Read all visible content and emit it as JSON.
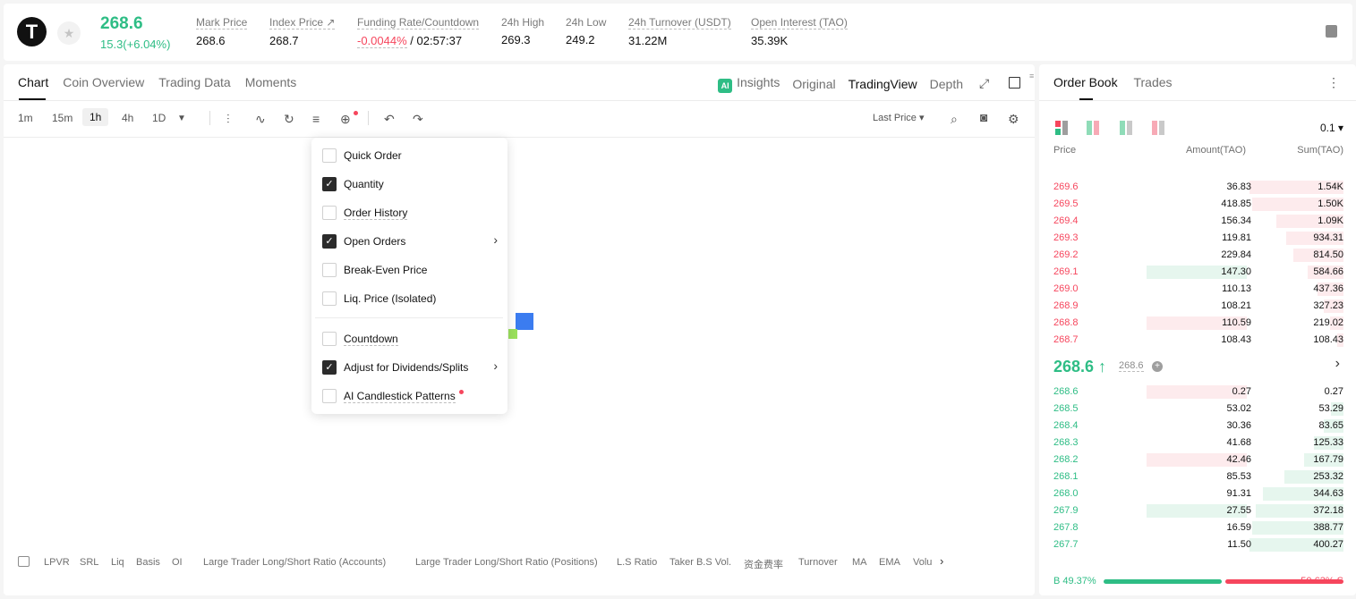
{
  "header": {
    "logo_letter": "T",
    "last_price": "268.6",
    "change": "15.3(+6.04%)",
    "stats": [
      {
        "label": "Mark Price",
        "value": "268.6"
      },
      {
        "label": "Index Price ↗",
        "value": "268.7"
      },
      {
        "label": "Funding Rate/Countdown",
        "value_red": "-0.0044%",
        "value": " / 02:57:37"
      },
      {
        "label": "24h High",
        "value": "269.3"
      },
      {
        "label": "24h Low",
        "value": "249.2"
      },
      {
        "label": "24h Turnover (USDT)",
        "value": "31.22M"
      },
      {
        "label": "Open Interest (TAO)",
        "value": "35.39K"
      }
    ]
  },
  "chart_tabs": [
    "Chart",
    "Coin Overview",
    "Trading Data",
    "Moments"
  ],
  "views": {
    "ai_badge": "AI",
    "insights": "Insights",
    "original": "Original",
    "tradingview": "TradingView",
    "depth": "Depth"
  },
  "intervals": [
    "1m",
    "15m",
    "1h",
    "4h",
    "1D"
  ],
  "toolbar": {
    "last_price": "Last Price ▾"
  },
  "dropdown": {
    "items": [
      {
        "label": "Quick Order",
        "checked": false,
        "arrow": false
      },
      {
        "label": "Quantity",
        "checked": true,
        "arrow": false
      },
      {
        "label": "Order History",
        "checked": false,
        "arrow": false
      },
      {
        "label": "Open Orders",
        "checked": true,
        "arrow": true
      },
      {
        "label": "Break-Even Price",
        "checked": false,
        "arrow": false
      },
      {
        "label": "Liq. Price (Isolated)",
        "checked": false,
        "arrow": false
      },
      {
        "label": "Countdown",
        "checked": false,
        "arrow": false
      },
      {
        "label": "Adjust for Dividends/Splits",
        "checked": true,
        "arrow": true
      },
      {
        "label": "AI Candlestick Patterns",
        "checked": false,
        "arrow": false
      }
    ]
  },
  "indicators": [
    "LPVR",
    "SRL",
    "Liq",
    "Basis",
    "OI",
    "Large Trader Long/Short Ratio (Accounts)",
    "Large Trader Long/Short Ratio (Positions)",
    "L.S Ratio",
    "Taker B.S Vol.",
    "资金费率",
    "Turnover",
    "MA",
    "EMA",
    "Volu"
  ],
  "orderbook": {
    "tabs": [
      "Order Book",
      "Trades"
    ],
    "step": "0.1 ▾",
    "headers": {
      "price": "Price",
      "amount": "Amount(TAO)",
      "sum": "Sum(TAO)"
    },
    "asks": [
      {
        "price": "269.6",
        "amount": "36.83",
        "sum": "1.54K",
        "depth": 1.0
      },
      {
        "price": "269.5",
        "amount": "418.85",
        "sum": "1.50K",
        "depth": 0.97
      },
      {
        "price": "269.4",
        "amount": "156.34",
        "sum": "1.09K",
        "depth": 0.71
      },
      {
        "price": "269.3",
        "amount": "119.81",
        "sum": "934.31",
        "depth": 0.61
      },
      {
        "price": "269.2",
        "amount": "229.84",
        "sum": "814.50",
        "depth": 0.53
      },
      {
        "price": "269.1",
        "amount": "147.30",
        "sum": "584.66",
        "depth": 0.38,
        "highlight": "green"
      },
      {
        "price": "269.0",
        "amount": "110.13",
        "sum": "437.36",
        "depth": 0.28
      },
      {
        "price": "268.9",
        "amount": "108.21",
        "sum": "327.23",
        "depth": 0.21
      },
      {
        "price": "268.8",
        "amount": "110.59",
        "sum": "219.02",
        "depth": 0.14,
        "highlight": "red"
      },
      {
        "price": "268.7",
        "amount": "108.43",
        "sum": "108.43",
        "depth": 0.07
      }
    ],
    "mid_price": "268.6 ↑",
    "mark": "268.6",
    "bids": [
      {
        "price": "268.6",
        "amount": "0.27",
        "sum": "0.27",
        "depth": 0.0,
        "highlight": "red"
      },
      {
        "price": "268.5",
        "amount": "53.02",
        "sum": "53.29",
        "depth": 0.13
      },
      {
        "price": "268.4",
        "amount": "30.36",
        "sum": "83.65",
        "depth": 0.21
      },
      {
        "price": "268.3",
        "amount": "41.68",
        "sum": "125.33",
        "depth": 0.31
      },
      {
        "price": "268.2",
        "amount": "42.46",
        "sum": "167.79",
        "depth": 0.42,
        "highlight": "red"
      },
      {
        "price": "268.1",
        "amount": "85.53",
        "sum": "253.32",
        "depth": 0.63
      },
      {
        "price": "268.0",
        "amount": "91.31",
        "sum": "344.63",
        "depth": 0.86
      },
      {
        "price": "267.9",
        "amount": "27.55",
        "sum": "372.18",
        "depth": 0.93,
        "highlight": "green"
      },
      {
        "price": "267.8",
        "amount": "16.59",
        "sum": "388.77",
        "depth": 0.97
      },
      {
        "price": "267.7",
        "amount": "11.50",
        "sum": "400.27",
        "depth": 1.0
      }
    ],
    "ratio": {
      "buy_label": "B 49.37%",
      "sell_label": "50.63% S",
      "buy": 0.4937
    }
  },
  "colors": {
    "green": "#2ebd85",
    "red": "#f6465d"
  }
}
